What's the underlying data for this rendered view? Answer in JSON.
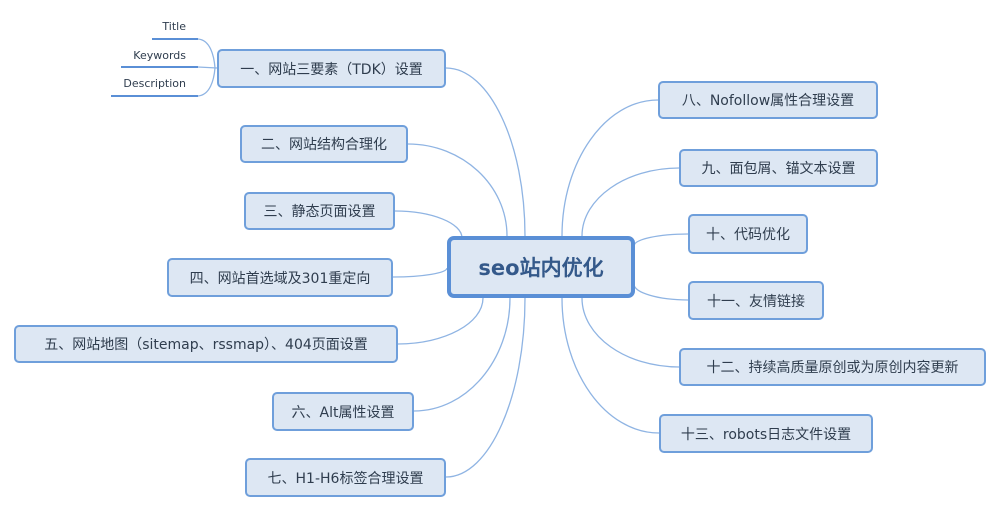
{
  "root": {
    "label": "seo站内优化"
  },
  "left_branches": [
    {
      "label": "一、网站三要素（TDK）设置",
      "children": [
        {
          "label": "Title"
        },
        {
          "label": "Keywords"
        },
        {
          "label": "Description"
        }
      ]
    },
    {
      "label": "二、网站结构合理化"
    },
    {
      "label": "三、静态页面设置"
    },
    {
      "label": "四、网站首选域及301重定向"
    },
    {
      "label": "五、网站地图（sitemap、rssmap）、404页面设置"
    },
    {
      "label": "六、Alt属性设置"
    },
    {
      "label": "七、H1-H6标签合理设置"
    }
  ],
  "right_branches": [
    {
      "label": "八、Nofollow属性合理设置"
    },
    {
      "label": "九、面包屑、锚文本设置"
    },
    {
      "label": "十、代码优化"
    },
    {
      "label": "十一、友情链接"
    },
    {
      "label": "十二、持续高质量原创或为原创内容更新"
    },
    {
      "label": "十三、robots日志文件设置"
    }
  ],
  "colors": {
    "line": "#8fb4e3",
    "node_fill": "#dde7f3",
    "node_border": "#6f9fdb",
    "root_border": "#5a8fd6",
    "root_text": "#34598a"
  }
}
